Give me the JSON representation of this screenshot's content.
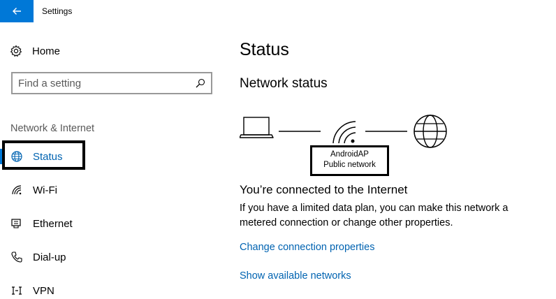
{
  "window": {
    "title": "Settings",
    "accent_color": "#0078d7",
    "back_icon": "arrow-left-icon"
  },
  "sidebar": {
    "home_label": "Home",
    "home_icon": "gear-icon",
    "search": {
      "placeholder": "Find a setting",
      "value": ""
    },
    "section_label": "Network & Internet",
    "items": [
      {
        "label": "Status",
        "icon": "globe-icon",
        "active": true
      },
      {
        "label": "Wi-Fi",
        "icon": "wifi-icon",
        "active": false
      },
      {
        "label": "Ethernet",
        "icon": "ethernet-icon",
        "active": false
      },
      {
        "label": "Dial-up",
        "icon": "phone-icon",
        "active": false
      },
      {
        "label": "VPN",
        "icon": "vpn-icon",
        "active": false
      }
    ]
  },
  "main": {
    "title": "Status",
    "network_status_heading": "Network status",
    "network": {
      "name": "AndroidAP",
      "type": "Public network"
    },
    "connected_heading": "You’re connected to the Internet",
    "description": "If you have a limited data plan, you can make this network a metered connection or change other properties.",
    "links": {
      "change_properties": "Change connection properties",
      "show_networks": "Show available networks"
    },
    "link_color": "#0063b1"
  }
}
